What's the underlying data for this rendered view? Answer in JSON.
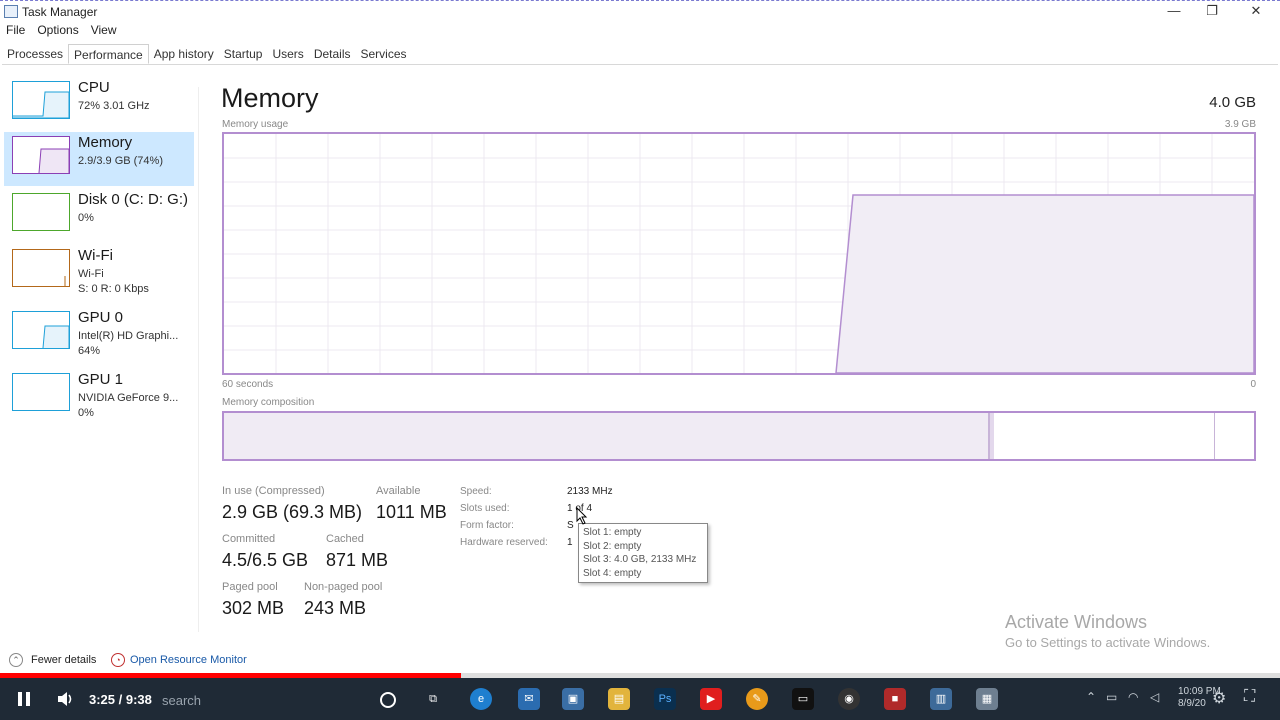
{
  "window": {
    "title": "Task Manager",
    "controls": [
      "—",
      "❐",
      "✕"
    ]
  },
  "menu": [
    "File",
    "Options",
    "View"
  ],
  "tabs": [
    "Processes",
    "Performance",
    "App history",
    "Startup",
    "Users",
    "Details",
    "Services"
  ],
  "active_tab": "Performance",
  "sidebar": {
    "items": [
      {
        "name": "CPU",
        "sub1": "72% 3.01 GHz",
        "sub2": "",
        "color": "#1ea0d8"
      },
      {
        "name": "Memory",
        "sub1": "2.9/3.9 GB (74%)",
        "sub2": "",
        "color": "#8b3fb5"
      },
      {
        "name": "Disk 0 (C: D: G:)",
        "sub1": "0%",
        "sub2": "",
        "color": "#4da72c"
      },
      {
        "name": "Wi-Fi",
        "sub1": "Wi-Fi",
        "sub2": "S: 0 R: 0 Kbps",
        "color": "#b3681a"
      },
      {
        "name": "GPU 0",
        "sub1": "Intel(R) HD Graphi...",
        "sub2": "64%",
        "color": "#1ea0d8"
      },
      {
        "name": "GPU 1",
        "sub1": "NVIDIA GeForce 9...",
        "sub2": "0%",
        "color": "#1ea0d8"
      }
    ]
  },
  "main": {
    "title": "Memory",
    "total": "4.0 GB",
    "usage_label": "Memory usage",
    "usage_max": "3.9 GB",
    "time_label": "60 seconds",
    "time_end": "0",
    "composition_label": "Memory composition"
  },
  "stats": {
    "in_use_label": "In use (Compressed)",
    "in_use_value": "2.9 GB (69.3 MB)",
    "available_label": "Available",
    "available_value": "1011 MB",
    "committed_label": "Committed",
    "committed_value": "4.5/6.5 GB",
    "cached_label": "Cached",
    "cached_value": "871 MB",
    "paged_label": "Paged pool",
    "paged_value": "302 MB",
    "nonpaged_label": "Non-paged pool",
    "nonpaged_value": "243 MB"
  },
  "specs": {
    "speed_label": "Speed:",
    "speed_value": "2133 MHz",
    "slots_label": "Slots used:",
    "slots_value": "1 of 4",
    "form_label": "Form factor:",
    "form_value": "S",
    "hw_label": "Hardware reserved:",
    "hw_value": "1"
  },
  "tooltip": [
    "Slot 1: empty",
    "Slot 2: empty",
    "Slot 3: 4.0 GB, 2133 MHz",
    "Slot 4: empty"
  ],
  "watermark": {
    "line1": "Activate Windows",
    "line2": "Go to Settings to activate Windows."
  },
  "footer": {
    "fewer_details": "Fewer details",
    "open_rm": "Open Resource Monitor"
  },
  "video": {
    "time": "3:25 / 9:38",
    "progress": 0.36,
    "search_ghost": "search"
  },
  "tray": {
    "time": "10:09 PM",
    "date": "8/9/20"
  }
}
